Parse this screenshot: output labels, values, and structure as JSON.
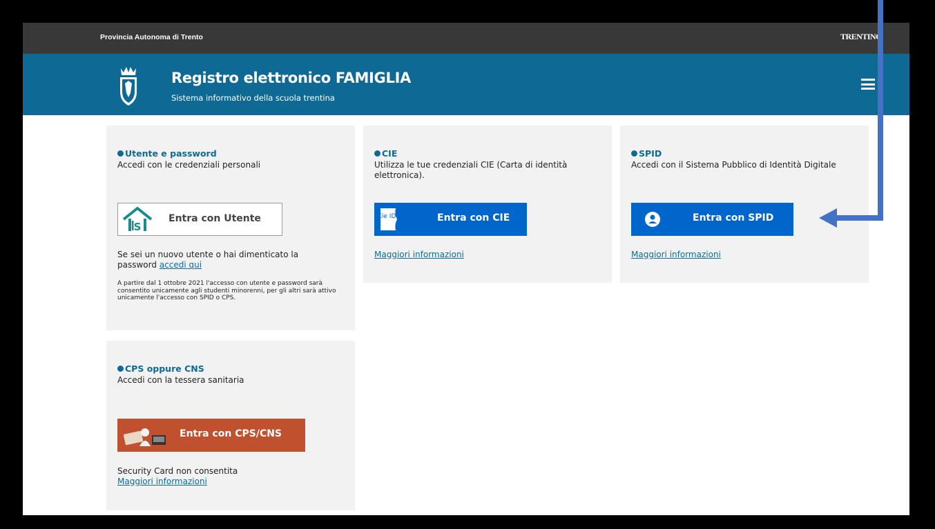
{
  "topbar": {
    "org": "Provincia Autonoma di Trento",
    "brand": "TRENTINO"
  },
  "header": {
    "title": "Registro elettronico FAMIGLIA",
    "subtitle": "Sistema informativo della scuola trentina"
  },
  "cards": {
    "utente": {
      "heading": "Utente e password",
      "desc": "Accedi con le credenziali personali",
      "button": "Entra con Utente",
      "note_prefix": "Se sei un nuovo utente o hai dimenticato la",
      "note_line2": "password",
      "note_link": "accedi qui",
      "small_text": "A partire dal 1 ottobre 2021 l'accesso con utente e password sarà consentito unicamente agli studenti minorenni, per gli altri sarà attivo unicamente l'accesso con SPID o CPS."
    },
    "cie": {
      "heading": "CIE",
      "desc": "Utilizza le tue credenziali CIE (Carta di identità elettronica).",
      "button": "Entra con CIE",
      "badge": "Cie ID",
      "link": "Maggiori informazioni"
    },
    "spid": {
      "heading": "SPID",
      "desc": "Accedi con il Sistema Pubblico di Identità Digitale",
      "button": "Entra con SPID",
      "link": "Maggiori informazioni"
    },
    "cps": {
      "heading": "CPS oppure CNS",
      "desc": "Accedi con la tessera sanitaria",
      "button": "Entra con CPS/CNS",
      "note": "Security Card non consentita",
      "link": "Maggiori informazioni"
    }
  },
  "colors": {
    "accent": "#0e6a94",
    "spid_blue": "#0066cc",
    "cps_red": "#c0512e",
    "annotation_arrow": "#4472c4"
  }
}
